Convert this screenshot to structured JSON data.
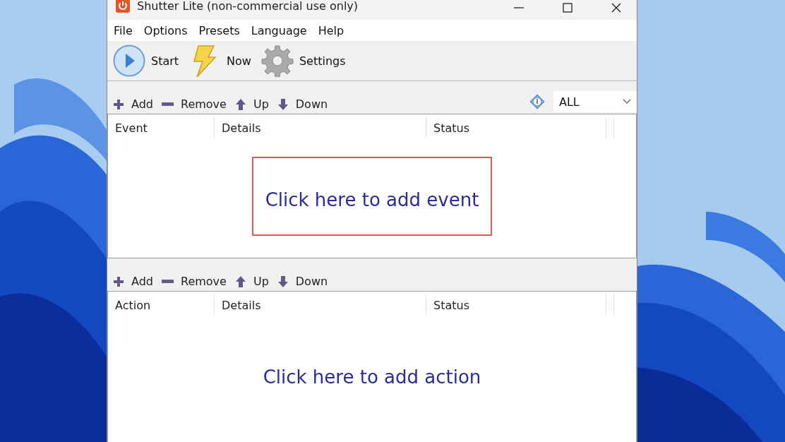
{
  "window": {
    "title": "Shutter Lite (non-commercial use only)"
  },
  "menu": [
    {
      "label": "File"
    },
    {
      "label": "Options"
    },
    {
      "label": "Presets"
    },
    {
      "label": "Language"
    },
    {
      "label": "Help"
    }
  ],
  "toolbar": [
    {
      "kind": "start",
      "label": "Start"
    },
    {
      "kind": "now",
      "label": "Now"
    },
    {
      "kind": "settings",
      "label": "Settings"
    }
  ],
  "events": {
    "tools": [
      {
        "kind": "add",
        "label": "Add"
      },
      {
        "kind": "remove",
        "label": "Remove"
      },
      {
        "kind": "up",
        "label": "Up"
      },
      {
        "kind": "down",
        "label": "Down"
      }
    ],
    "filter": {
      "value": "ALL"
    },
    "columns": [
      "Event",
      "Details",
      "Status"
    ],
    "empty_text": "Click here to add event",
    "highlighted": true
  },
  "actions": {
    "tools": [
      {
        "kind": "add",
        "label": "Add"
      },
      {
        "kind": "remove",
        "label": "Remove"
      },
      {
        "kind": "up",
        "label": "Up"
      },
      {
        "kind": "down",
        "label": "Down"
      }
    ],
    "columns": [
      "Action",
      "Details",
      "Status"
    ],
    "empty_text": "Click here to add action",
    "highlighted": false
  }
}
